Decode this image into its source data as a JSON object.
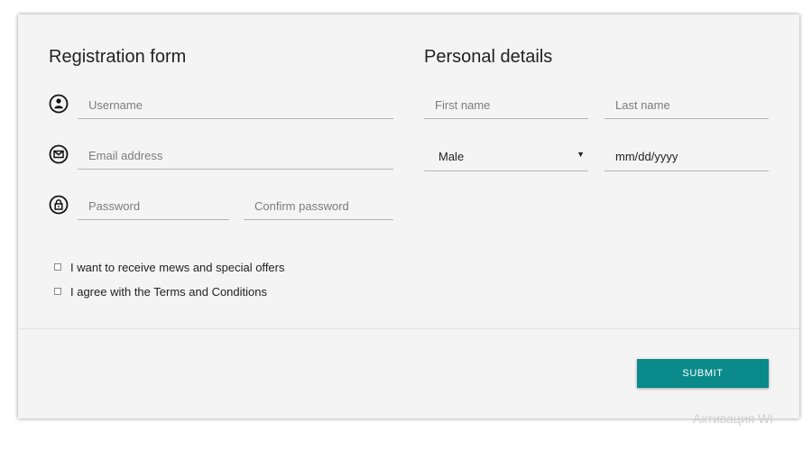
{
  "registration": {
    "title": "Registration form",
    "username_placeholder": "Username",
    "email_placeholder": "Email address",
    "password_placeholder": "Password",
    "confirm_password_placeholder": "Confirm password"
  },
  "personal": {
    "title": "Personal details",
    "first_name_placeholder": "First name",
    "last_name_placeholder": "Last name",
    "gender_selected": "Male",
    "date_value": "mm/dd/yyyy"
  },
  "checkboxes": [
    {
      "label": "I want to receive mews and special offers",
      "checked": false
    },
    {
      "label": "I agree with the Terms and Conditions",
      "checked": false
    }
  ],
  "submit_label": "SUBMIT",
  "watermark_text": "Активация Wi",
  "icons": {
    "username": "user-circle-icon",
    "email": "envelope-circle-icon",
    "password": "lock-circle-icon",
    "select_caret": "triangle-down-icon"
  },
  "colors": {
    "accent": "#0a8a8a",
    "card_background": "#f4f4f4",
    "field_underline": "#b4b4b4"
  }
}
